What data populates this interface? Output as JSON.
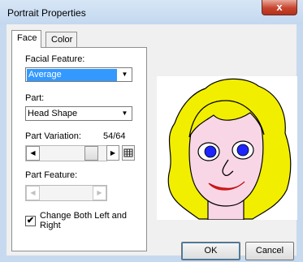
{
  "window": {
    "title": "Portrait Properties",
    "close_glyph": "x"
  },
  "tabs": [
    {
      "label": "Face",
      "active": true
    },
    {
      "label": "Color",
      "active": false
    }
  ],
  "facial_feature": {
    "label": "Facial Feature:",
    "value": "Average"
  },
  "part": {
    "label": "Part:",
    "value": "Head Shape"
  },
  "part_variation": {
    "label": "Part Variation:",
    "value_text": "54/64",
    "fraction": 0.84
  },
  "part_feature": {
    "label": "Part Feature:"
  },
  "change_both": {
    "label_line1": "Change Both Left and",
    "label_line2": "Right",
    "checked": true,
    "mark": "✔"
  },
  "buttons": {
    "ok": "OK",
    "cancel": "Cancel"
  },
  "portrait_colors": {
    "hair": "#f2ee00",
    "skin": "#f8d6e6",
    "eyes": "#1e26ff",
    "mouth": "#e82020"
  }
}
